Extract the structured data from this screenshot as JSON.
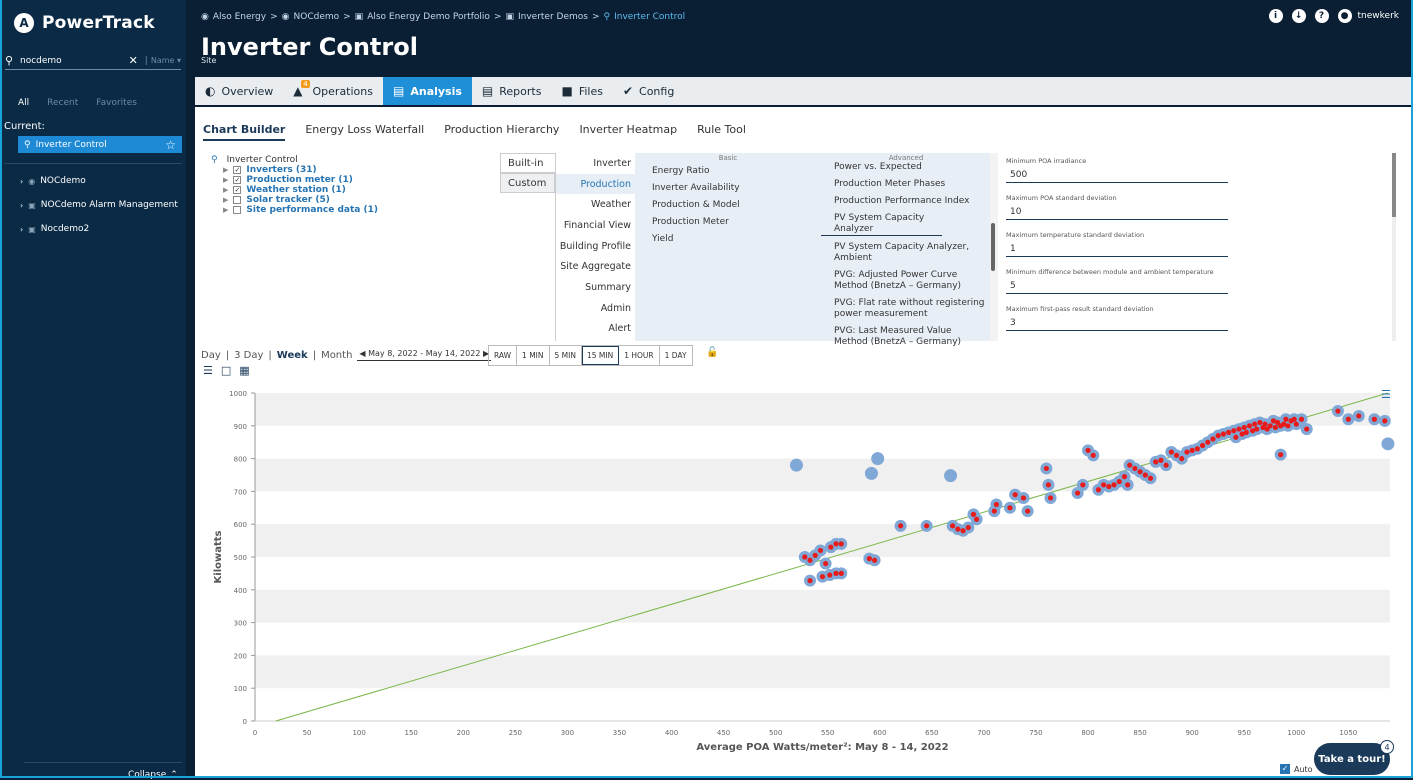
{
  "sidebar": {
    "logo": "PowerTrack",
    "search": {
      "value": "nocdemo",
      "sort_label": "Name"
    },
    "tabs": [
      "All",
      "Recent",
      "Favorites"
    ],
    "current_label": "Current:",
    "current_item": "Inverter Control",
    "tree": [
      "NOCdemo",
      "NOCdemo Alarm Management",
      "Nocdemo2"
    ],
    "collapse_label": "Collapse"
  },
  "header": {
    "breadcrumb": [
      "Also Energy",
      "NOCdemo",
      "Also Energy Demo Portfolio",
      "Inverter Demos",
      "Inverter Control"
    ],
    "title": "Inverter Control",
    "subtitle": "Site",
    "user": "tnewkerk"
  },
  "nav": {
    "tabs": [
      {
        "label": "Overview",
        "icon": "gauge-icon"
      },
      {
        "label": "Operations",
        "icon": "warning-icon",
        "badge": "4"
      },
      {
        "label": "Analysis",
        "icon": "chart-icon",
        "active": true
      },
      {
        "label": "Reports",
        "icon": "document-icon"
      },
      {
        "label": "Files",
        "icon": "folder-icon"
      },
      {
        "label": "Config",
        "icon": "wrench-icon"
      }
    ]
  },
  "subtabs": [
    "Chart Builder",
    "Energy Loss Waterfall",
    "Production Hierarchy",
    "Inverter Heatmap",
    "Rule Tool"
  ],
  "tree": {
    "root": "Inverter Control",
    "items": [
      {
        "label": "Inverters (31)",
        "checked": true
      },
      {
        "label": "Production meter (1)",
        "checked": true
      },
      {
        "label": "Weather station (1)",
        "checked": true
      },
      {
        "label": "Solar tracker (5)",
        "checked": false
      },
      {
        "label": "Site performance data (1)",
        "checked": false
      }
    ]
  },
  "builder": {
    "builtin": "Built-in",
    "custom": "Custom",
    "categories": [
      "Inverter",
      "Production",
      "Weather",
      "Financial View",
      "Building Profile",
      "Site Aggregate",
      "Summary",
      "Admin",
      "Alert"
    ],
    "basic_label": "Basic",
    "basic": [
      "Energy Ratio",
      "Inverter Availability",
      "Production & Model",
      "Production Meter",
      "Yield"
    ],
    "advanced_label": "Advanced",
    "advanced": [
      "Power vs. Expected",
      "Production Meter Phases",
      "Production Performance Index",
      "PV System Capacity Analyzer",
      "PV System Capacity Analyzer, Ambient",
      "PVG: Adjusted Power Curve Method (BnetzA – Germany)",
      "PVG: Flat rate without registering power measurement",
      "PVG: Last Measured Value Method (BnetzA – Germany)"
    ]
  },
  "params": [
    {
      "label": "Minimum POA irradiance",
      "value": "500"
    },
    {
      "label": "Maximum POA standard deviation",
      "value": "10"
    },
    {
      "label": "Maximum temperature standard deviation",
      "value": "1"
    },
    {
      "label": "Minimum difference between module and ambient temperature",
      "value": "5"
    },
    {
      "label": "Maximum first-pass result standard deviation",
      "value": "3"
    }
  ],
  "timeline": {
    "ranges": [
      "Day",
      "3 Day",
      "Week",
      "Month"
    ],
    "active": "Week",
    "date_range": "May 8, 2022 - May 14, 2022",
    "intervals": [
      "RAW",
      "1 MIN",
      "5 MIN",
      "15 MIN",
      "1 HOUR",
      "1 DAY"
    ],
    "active_interval": "15 MIN"
  },
  "chart_data": {
    "type": "scatter",
    "xlabel": "Average POA Watts/meter²: May 8 - 14, 2022",
    "ylabel": "Kilowatts",
    "xlim": [
      0,
      1090
    ],
    "ylim": [
      0,
      1000
    ],
    "xticks": [
      0,
      50,
      100,
      150,
      200,
      250,
      300,
      350,
      400,
      450,
      500,
      550,
      600,
      650,
      700,
      750,
      800,
      850,
      900,
      950,
      1000,
      1050
    ],
    "yticks": [
      0,
      100,
      200,
      300,
      400,
      500,
      600,
      700,
      800,
      900,
      1000
    ],
    "trendline": [
      [
        20,
        0
      ],
      [
        1088,
        1000
      ]
    ],
    "outliers": [
      [
        520,
        780
      ],
      [
        592,
        755
      ],
      [
        598,
        800
      ],
      [
        668,
        748
      ],
      [
        1088,
        845
      ]
    ],
    "points": [
      [
        528,
        500
      ],
      [
        533,
        490
      ],
      [
        538,
        505
      ],
      [
        543,
        520
      ],
      [
        548,
        480
      ],
      [
        553,
        530
      ],
      [
        558,
        540
      ],
      [
        563,
        540
      ],
      [
        533,
        428
      ],
      [
        545,
        440
      ],
      [
        552,
        445
      ],
      [
        558,
        450
      ],
      [
        563,
        450
      ],
      [
        590,
        495
      ],
      [
        595,
        490
      ],
      [
        620,
        595
      ],
      [
        645,
        595
      ],
      [
        670,
        595
      ],
      [
        675,
        585
      ],
      [
        680,
        580
      ],
      [
        685,
        590
      ],
      [
        690,
        630
      ],
      [
        693,
        615
      ],
      [
        710,
        640
      ],
      [
        712,
        660
      ],
      [
        725,
        650
      ],
      [
        730,
        690
      ],
      [
        738,
        680
      ],
      [
        742,
        640
      ],
      [
        760,
        770
      ],
      [
        762,
        720
      ],
      [
        764,
        680
      ],
      [
        790,
        695
      ],
      [
        795,
        720
      ],
      [
        800,
        825
      ],
      [
        805,
        810
      ],
      [
        810,
        705
      ],
      [
        815,
        720
      ],
      [
        820,
        715
      ],
      [
        825,
        720
      ],
      [
        830,
        730
      ],
      [
        835,
        745
      ],
      [
        838,
        720
      ],
      [
        840,
        780
      ],
      [
        845,
        770
      ],
      [
        850,
        760
      ],
      [
        855,
        750
      ],
      [
        860,
        740
      ],
      [
        865,
        790
      ],
      [
        870,
        795
      ],
      [
        875,
        780
      ],
      [
        880,
        820
      ],
      [
        885,
        810
      ],
      [
        890,
        800
      ],
      [
        895,
        820
      ],
      [
        900,
        825
      ],
      [
        905,
        830
      ],
      [
        910,
        840
      ],
      [
        915,
        850
      ],
      [
        920,
        860
      ],
      [
        925,
        870
      ],
      [
        930,
        875
      ],
      [
        935,
        880
      ],
      [
        940,
        885
      ],
      [
        942,
        865
      ],
      [
        945,
        890
      ],
      [
        948,
        875
      ],
      [
        950,
        895
      ],
      [
        952,
        880
      ],
      [
        955,
        900
      ],
      [
        958,
        885
      ],
      [
        960,
        905
      ],
      [
        962,
        890
      ],
      [
        965,
        910
      ],
      [
        968,
        895
      ],
      [
        970,
        905
      ],
      [
        972,
        890
      ],
      [
        975,
        900
      ],
      [
        978,
        915
      ],
      [
        980,
        895
      ],
      [
        982,
        910
      ],
      [
        985,
        900
      ],
      [
        988,
        905
      ],
      [
        990,
        920
      ],
      [
        992,
        900
      ],
      [
        995,
        915
      ],
      [
        998,
        920
      ],
      [
        1000,
        905
      ],
      [
        1005,
        920
      ],
      [
        1010,
        890
      ],
      [
        985,
        812
      ],
      [
        1040,
        945
      ],
      [
        1050,
        920
      ],
      [
        1060,
        930
      ],
      [
        1075,
        920
      ],
      [
        1085,
        915
      ]
    ]
  },
  "legend_icon": "list-icon",
  "auto_fit_label": "Auto",
  "tour": {
    "label": "Take a tour!",
    "badge": "4"
  },
  "colors": {
    "accent": "#1f90d8",
    "navy": "#0b2a45",
    "point_outer": "#7fa8d6",
    "point_inner": "#e81b1b",
    "trend": "#7ab648"
  }
}
